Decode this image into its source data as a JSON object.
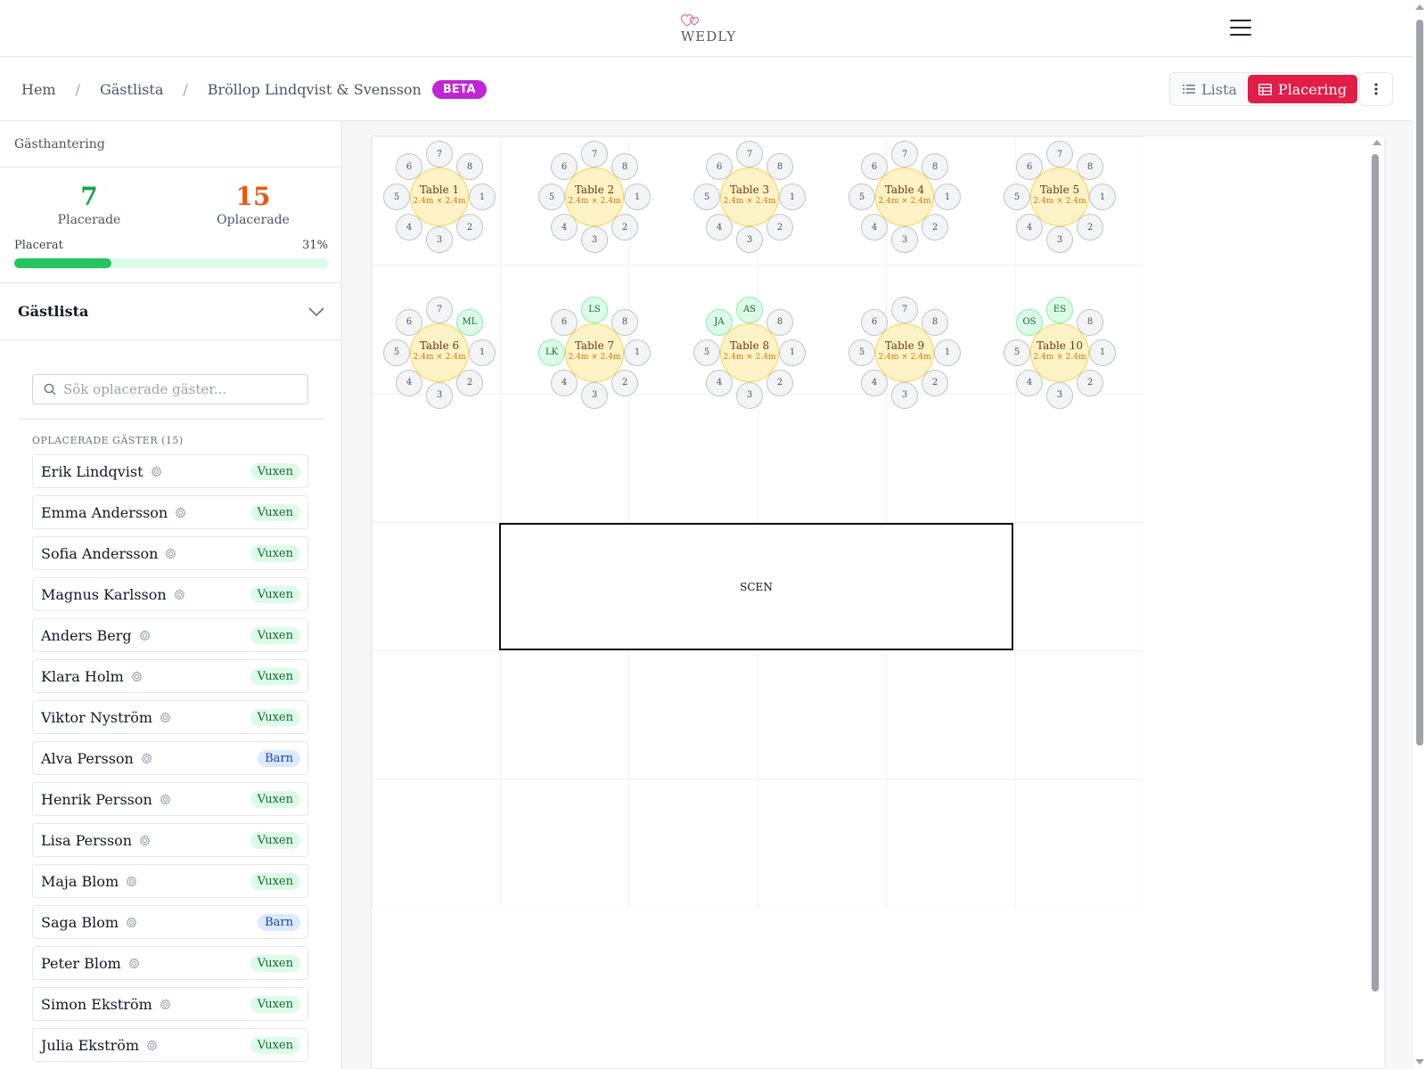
{
  "header": {
    "logo_text": "WEDLY"
  },
  "breadcrumb": {
    "items": [
      "Hem",
      "Gästlista",
      "Bröllop Lindqvist & Svensson"
    ],
    "badge": "BETA"
  },
  "view_toggle": {
    "list_label": "Lista",
    "placement_label": "Placering"
  },
  "sidebar": {
    "title": "Gästhantering",
    "placed_count": "7",
    "placed_label": "Placerade",
    "unplaced_count": "15",
    "unplaced_label": "Oplacerade",
    "progress_label": "Placerat",
    "progress_text": "31%",
    "progress_fraction": 0.31,
    "guestlist_title": "Gästlista",
    "search_placeholder": "Sök oplacerade gäster...",
    "section_label": "OPLACERADE GÄSTER (15)",
    "guests": [
      {
        "name": "Erik Lindqvist",
        "type": "Vuxen"
      },
      {
        "name": "Emma Andersson",
        "type": "Vuxen"
      },
      {
        "name": "Sofia Andersson",
        "type": "Vuxen"
      },
      {
        "name": "Magnus Karlsson",
        "type": "Vuxen"
      },
      {
        "name": "Anders Berg",
        "type": "Vuxen"
      },
      {
        "name": "Klara Holm",
        "type": "Vuxen"
      },
      {
        "name": "Viktor Nyström",
        "type": "Vuxen"
      },
      {
        "name": "Alva Persson",
        "type": "Barn"
      },
      {
        "name": "Henrik Persson",
        "type": "Vuxen"
      },
      {
        "name": "Lisa Persson",
        "type": "Vuxen"
      },
      {
        "name": "Maja Blom",
        "type": "Vuxen"
      },
      {
        "name": "Saga Blom",
        "type": "Barn"
      },
      {
        "name": "Peter Blom",
        "type": "Vuxen"
      },
      {
        "name": "Simon Ekström",
        "type": "Vuxen"
      },
      {
        "name": "Julia Ekström",
        "type": "Vuxen"
      }
    ]
  },
  "floor": {
    "stage_label": "SCEN",
    "tables": [
      {
        "name": "Table 1",
        "size": "2.4m × 2.4m",
        "seats": {}
      },
      {
        "name": "Table 2",
        "size": "2.4m × 2.4m",
        "seats": {}
      },
      {
        "name": "Table 3",
        "size": "2.4m × 2.4m",
        "seats": {}
      },
      {
        "name": "Table 4",
        "size": "2.4m × 2.4m",
        "seats": {}
      },
      {
        "name": "Table 5",
        "size": "2.4m × 2.4m",
        "seats": {}
      },
      {
        "name": "Table 6",
        "size": "2.4m × 2.4m",
        "seats": {
          "8": "ML"
        }
      },
      {
        "name": "Table 7",
        "size": "2.4m × 2.4m",
        "seats": {
          "7": "LS",
          "5": "LK"
        }
      },
      {
        "name": "Table 8",
        "size": "2.4m × 2.4m",
        "seats": {
          "7": "AS",
          "6": "JA"
        }
      },
      {
        "name": "Table 9",
        "size": "2.4m × 2.4m",
        "seats": {}
      },
      {
        "name": "Table 10",
        "size": "2.4m × 2.4m",
        "seats": {
          "7": "ES",
          "6": "OS"
        }
      }
    ]
  }
}
